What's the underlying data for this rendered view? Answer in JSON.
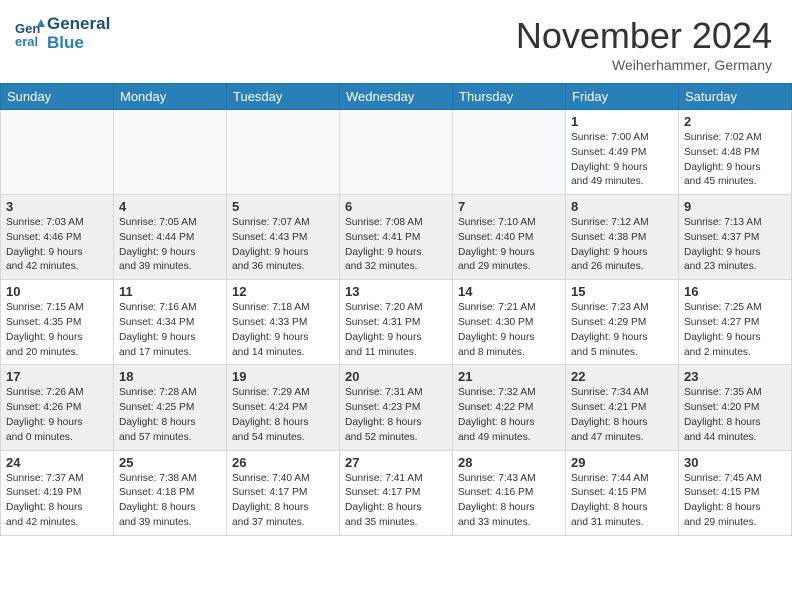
{
  "header": {
    "logo_line1": "General",
    "logo_line2": "Blue",
    "month": "November 2024",
    "location": "Weiherhammer, Germany"
  },
  "days_of_week": [
    "Sunday",
    "Monday",
    "Tuesday",
    "Wednesday",
    "Thursday",
    "Friday",
    "Saturday"
  ],
  "weeks": [
    [
      {
        "day": "",
        "info": ""
      },
      {
        "day": "",
        "info": ""
      },
      {
        "day": "",
        "info": ""
      },
      {
        "day": "",
        "info": ""
      },
      {
        "day": "",
        "info": ""
      },
      {
        "day": "1",
        "info": "Sunrise: 7:00 AM\nSunset: 4:49 PM\nDaylight: 9 hours\nand 49 minutes."
      },
      {
        "day": "2",
        "info": "Sunrise: 7:02 AM\nSunset: 4:48 PM\nDaylight: 9 hours\nand 45 minutes."
      }
    ],
    [
      {
        "day": "3",
        "info": "Sunrise: 7:03 AM\nSunset: 4:46 PM\nDaylight: 9 hours\nand 42 minutes."
      },
      {
        "day": "4",
        "info": "Sunrise: 7:05 AM\nSunset: 4:44 PM\nDaylight: 9 hours\nand 39 minutes."
      },
      {
        "day": "5",
        "info": "Sunrise: 7:07 AM\nSunset: 4:43 PM\nDaylight: 9 hours\nand 36 minutes."
      },
      {
        "day": "6",
        "info": "Sunrise: 7:08 AM\nSunset: 4:41 PM\nDaylight: 9 hours\nand 32 minutes."
      },
      {
        "day": "7",
        "info": "Sunrise: 7:10 AM\nSunset: 4:40 PM\nDaylight: 9 hours\nand 29 minutes."
      },
      {
        "day": "8",
        "info": "Sunrise: 7:12 AM\nSunset: 4:38 PM\nDaylight: 9 hours\nand 26 minutes."
      },
      {
        "day": "9",
        "info": "Sunrise: 7:13 AM\nSunset: 4:37 PM\nDaylight: 9 hours\nand 23 minutes."
      }
    ],
    [
      {
        "day": "10",
        "info": "Sunrise: 7:15 AM\nSunset: 4:35 PM\nDaylight: 9 hours\nand 20 minutes."
      },
      {
        "day": "11",
        "info": "Sunrise: 7:16 AM\nSunset: 4:34 PM\nDaylight: 9 hours\nand 17 minutes."
      },
      {
        "day": "12",
        "info": "Sunrise: 7:18 AM\nSunset: 4:33 PM\nDaylight: 9 hours\nand 14 minutes."
      },
      {
        "day": "13",
        "info": "Sunrise: 7:20 AM\nSunset: 4:31 PM\nDaylight: 9 hours\nand 11 minutes."
      },
      {
        "day": "14",
        "info": "Sunrise: 7:21 AM\nSunset: 4:30 PM\nDaylight: 9 hours\nand 8 minutes."
      },
      {
        "day": "15",
        "info": "Sunrise: 7:23 AM\nSunset: 4:29 PM\nDaylight: 9 hours\nand 5 minutes."
      },
      {
        "day": "16",
        "info": "Sunrise: 7:25 AM\nSunset: 4:27 PM\nDaylight: 9 hours\nand 2 minutes."
      }
    ],
    [
      {
        "day": "17",
        "info": "Sunrise: 7:26 AM\nSunset: 4:26 PM\nDaylight: 9 hours\nand 0 minutes."
      },
      {
        "day": "18",
        "info": "Sunrise: 7:28 AM\nSunset: 4:25 PM\nDaylight: 8 hours\nand 57 minutes."
      },
      {
        "day": "19",
        "info": "Sunrise: 7:29 AM\nSunset: 4:24 PM\nDaylight: 8 hours\nand 54 minutes."
      },
      {
        "day": "20",
        "info": "Sunrise: 7:31 AM\nSunset: 4:23 PM\nDaylight: 8 hours\nand 52 minutes."
      },
      {
        "day": "21",
        "info": "Sunrise: 7:32 AM\nSunset: 4:22 PM\nDaylight: 8 hours\nand 49 minutes."
      },
      {
        "day": "22",
        "info": "Sunrise: 7:34 AM\nSunset: 4:21 PM\nDaylight: 8 hours\nand 47 minutes."
      },
      {
        "day": "23",
        "info": "Sunrise: 7:35 AM\nSunset: 4:20 PM\nDaylight: 8 hours\nand 44 minutes."
      }
    ],
    [
      {
        "day": "24",
        "info": "Sunrise: 7:37 AM\nSunset: 4:19 PM\nDaylight: 8 hours\nand 42 minutes."
      },
      {
        "day": "25",
        "info": "Sunrise: 7:38 AM\nSunset: 4:18 PM\nDaylight: 8 hours\nand 39 minutes."
      },
      {
        "day": "26",
        "info": "Sunrise: 7:40 AM\nSunset: 4:17 PM\nDaylight: 8 hours\nand 37 minutes."
      },
      {
        "day": "27",
        "info": "Sunrise: 7:41 AM\nSunset: 4:17 PM\nDaylight: 8 hours\nand 35 minutes."
      },
      {
        "day": "28",
        "info": "Sunrise: 7:43 AM\nSunset: 4:16 PM\nDaylight: 8 hours\nand 33 minutes."
      },
      {
        "day": "29",
        "info": "Sunrise: 7:44 AM\nSunset: 4:15 PM\nDaylight: 8 hours\nand 31 minutes."
      },
      {
        "day": "30",
        "info": "Sunrise: 7:45 AM\nSunset: 4:15 PM\nDaylight: 8 hours\nand 29 minutes."
      }
    ]
  ]
}
